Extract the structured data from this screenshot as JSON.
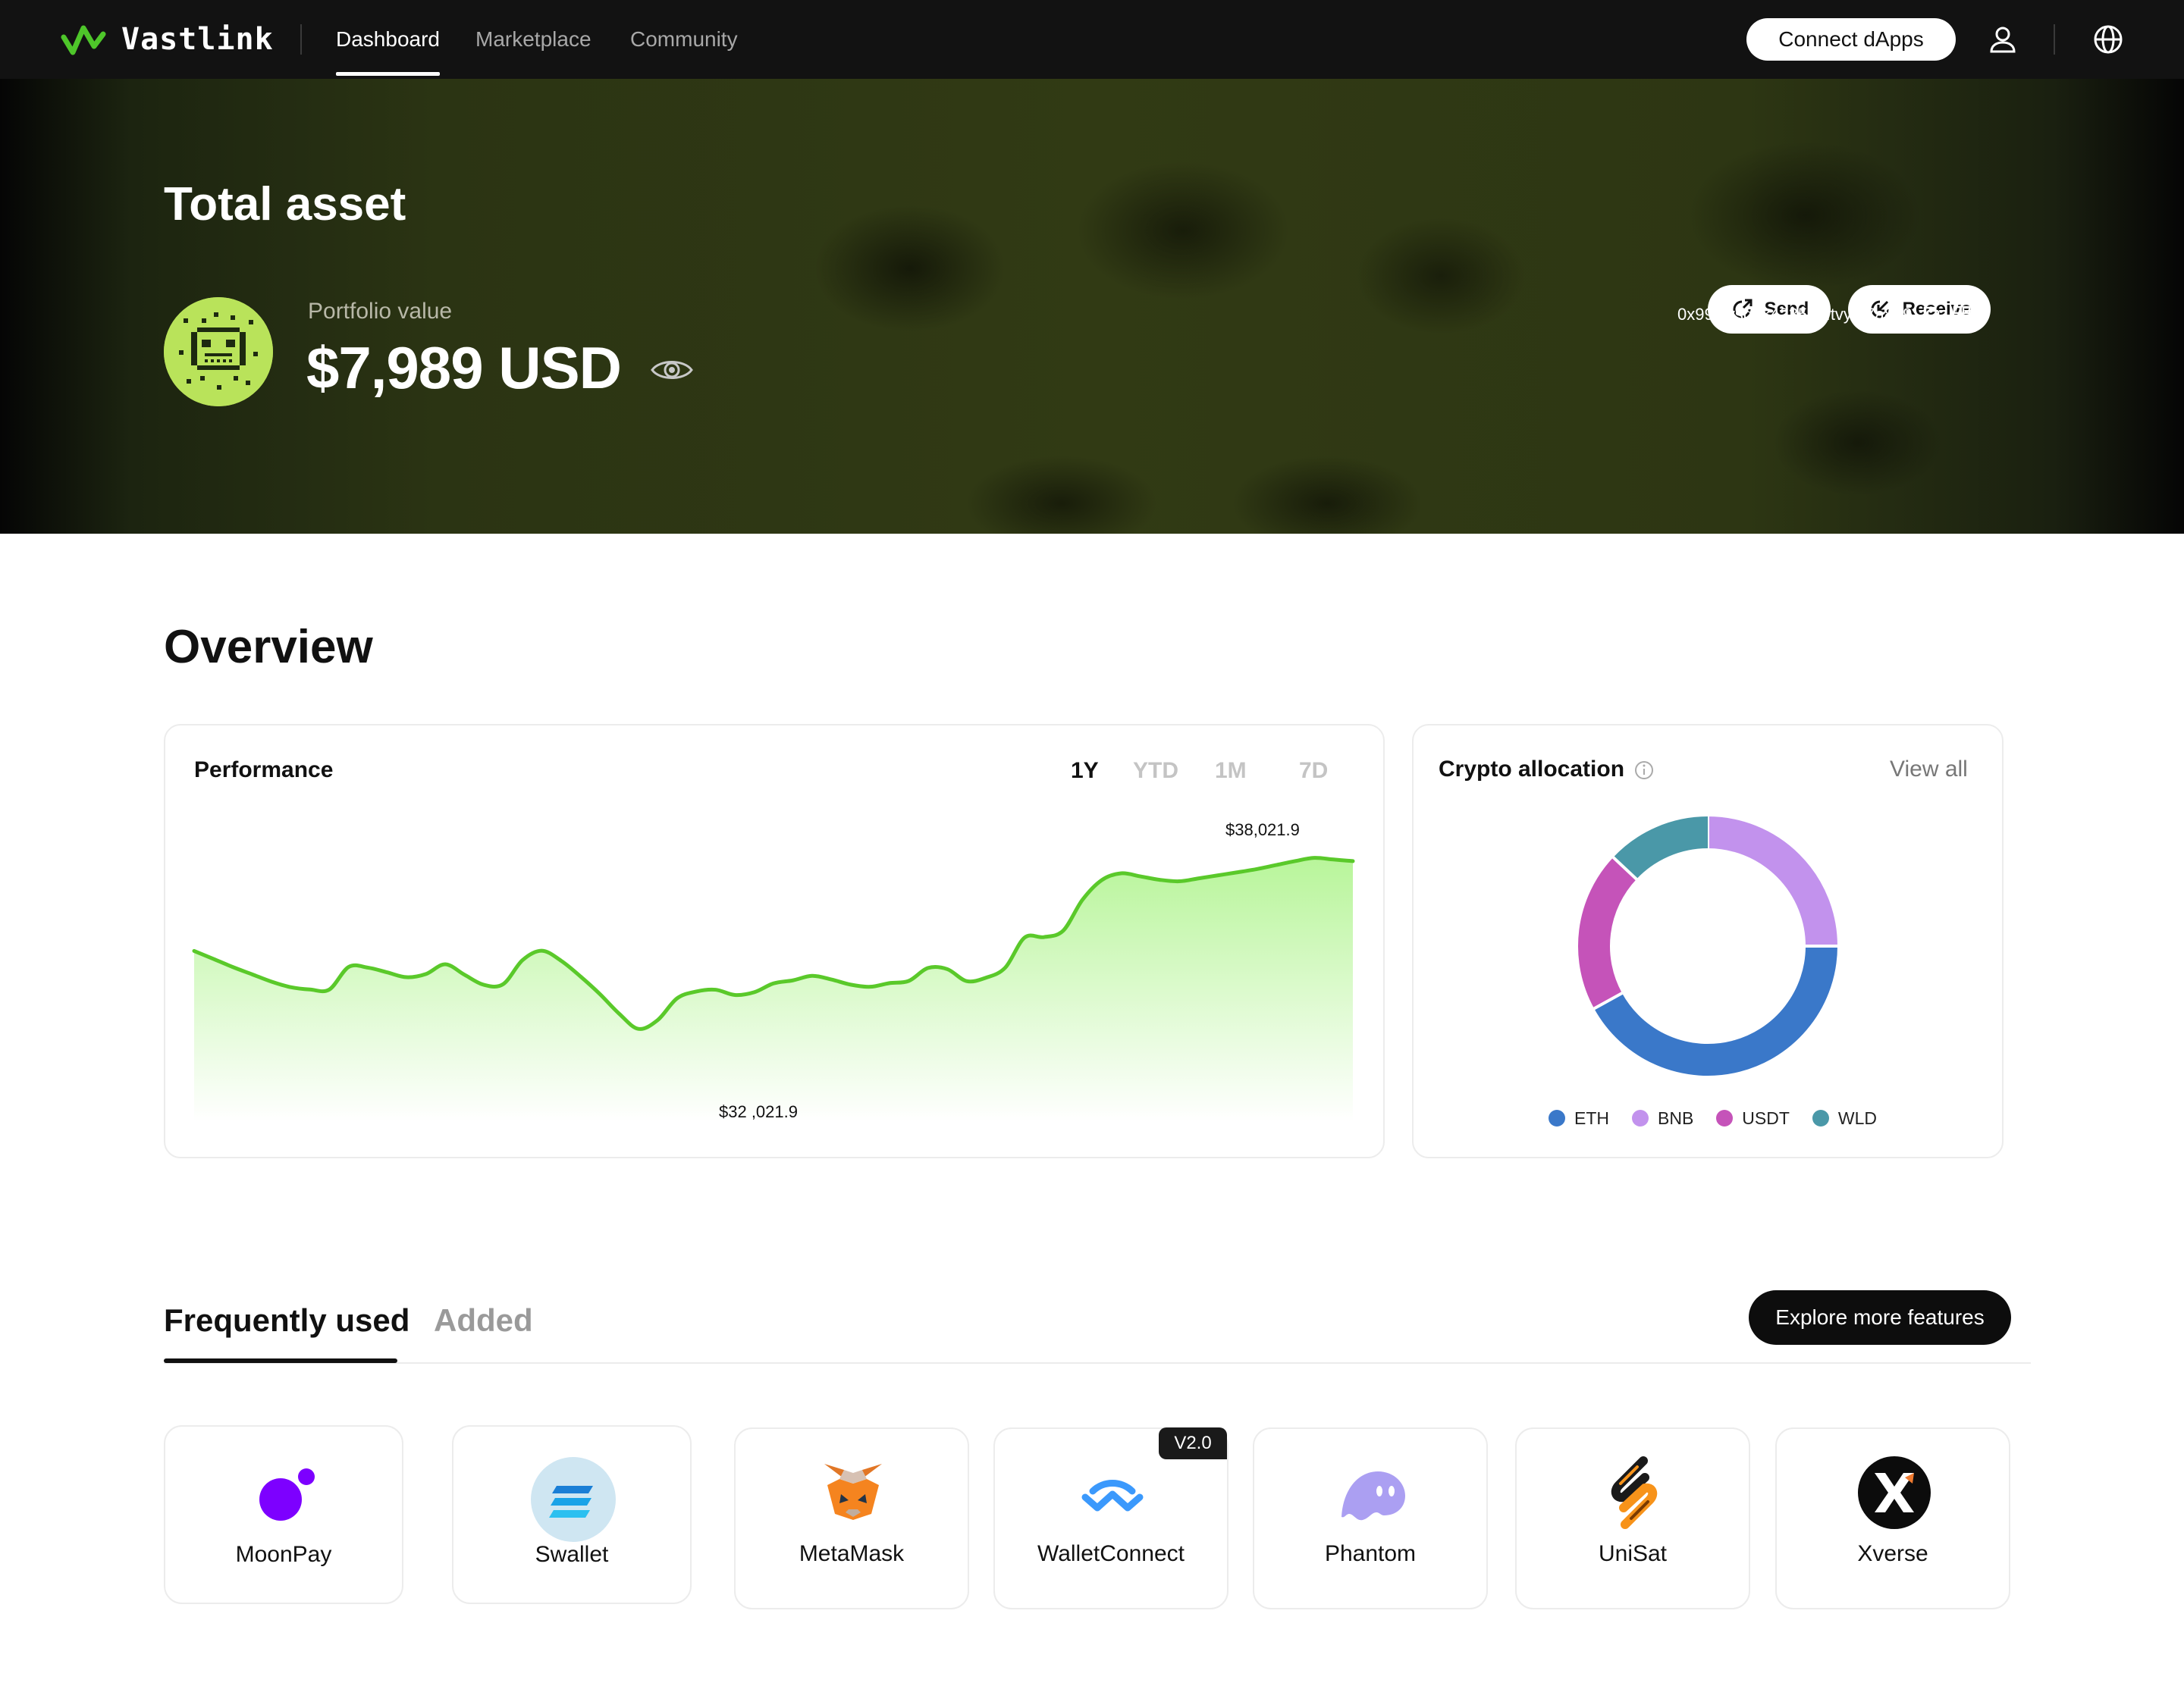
{
  "nav": {
    "brand": "Vastlink",
    "links": [
      {
        "label": "Dashboard",
        "active": true
      },
      {
        "label": "Marketplace",
        "active": false
      },
      {
        "label": "Community",
        "active": false
      }
    ],
    "connect_label": "Connect dApps",
    "icons": [
      "user-icon",
      "globe-icon"
    ]
  },
  "hero": {
    "title": "Total asset",
    "portfolio_label": "Portfolio value",
    "portfolio_value": "$7,989 USD",
    "send_label": "Send",
    "receive_label": "Receive",
    "address": "0x99biysgfi34235.utftvyt77a859"
  },
  "overview": {
    "title": "Overview",
    "performance": {
      "title": "Performance",
      "periods": [
        {
          "label": "1Y",
          "active": true
        },
        {
          "label": "YTD",
          "active": false
        },
        {
          "label": "1M",
          "active": false
        },
        {
          "label": "7D",
          "active": false
        }
      ]
    },
    "allocation": {
      "title": "Crypto allocation",
      "view_all": "View all"
    }
  },
  "chart_data": [
    {
      "type": "area",
      "title": "Performance",
      "annotations": [
        {
          "label": "$38,021.9",
          "kind": "max"
        },
        {
          "label": "$32 ,021.9",
          "kind": "min"
        }
      ],
      "x": [
        0,
        1,
        2,
        3,
        4,
        5,
        6,
        7,
        8,
        9,
        10,
        11,
        12,
        13,
        14,
        15,
        16,
        17,
        18,
        19,
        20,
        21,
        22,
        23,
        24,
        25,
        26,
        27,
        28,
        29,
        30,
        31,
        32,
        33,
        34,
        35,
        36,
        37,
        38,
        39,
        40,
        41,
        42,
        43,
        44,
        45,
        46,
        47,
        48,
        49,
        50,
        51,
        52,
        53,
        54,
        55,
        56,
        57,
        58,
        59,
        60
      ],
      "values": [
        35667,
        35469,
        35267,
        35086,
        34904,
        34766,
        34708,
        34708,
        35269,
        35252,
        35134,
        35014,
        35093,
        35336,
        35075,
        34825,
        34840,
        35436,
        35672,
        35424,
        35035,
        34600,
        34111,
        33730,
        33947,
        34486,
        34658,
        34703,
        34572,
        34640,
        34859,
        34935,
        35047,
        34957,
        34829,
        34776,
        34867,
        34921,
        35243,
        35214,
        34917,
        35001,
        35252,
        35998,
        36011,
        36171,
        36939,
        37429,
        37597,
        37520,
        37435,
        37398,
        37470,
        37545,
        37620,
        37700,
        37800,
        37900,
        37980,
        37940,
        37900
      ],
      "color": "#5ac92a",
      "fill_gradient": [
        "#b8f59a",
        "#ffffff"
      ],
      "grid": false
    },
    {
      "type": "pie",
      "title": "Crypto allocation",
      "donut": true,
      "categories": [
        "ETH",
        "BNB",
        "USDT",
        "WLD"
      ],
      "values": [
        42,
        25,
        20,
        13
      ],
      "colors": [
        "#3a78c9",
        "#c292ed",
        "#c553b9",
        "#4a98a8"
      ],
      "legend_position": "bottom"
    }
  ],
  "tabs": [
    {
      "label": "Frequently used",
      "active": true
    },
    {
      "label": "Added",
      "active": false
    }
  ],
  "explore_label": "Explore more features",
  "apps": [
    {
      "name": "MoonPay",
      "icon": "moonpay-icon"
    },
    {
      "name": "Swallet",
      "icon": "swallet-icon"
    },
    {
      "name": "MetaMask",
      "icon": "metamask-icon"
    },
    {
      "name": "WalletConnect",
      "icon": "walletconnect-icon",
      "badge": "V2.0"
    },
    {
      "name": "Phantom",
      "icon": "phantom-icon"
    },
    {
      "name": "UniSat",
      "icon": "unisat-icon"
    },
    {
      "name": "Xverse",
      "icon": "xverse-icon"
    }
  ],
  "colors": {
    "accent_green": "#5ac92a",
    "nav_bg": "#121212",
    "hero_bg": "#313a14",
    "avatar_green": "#b9e35a"
  }
}
